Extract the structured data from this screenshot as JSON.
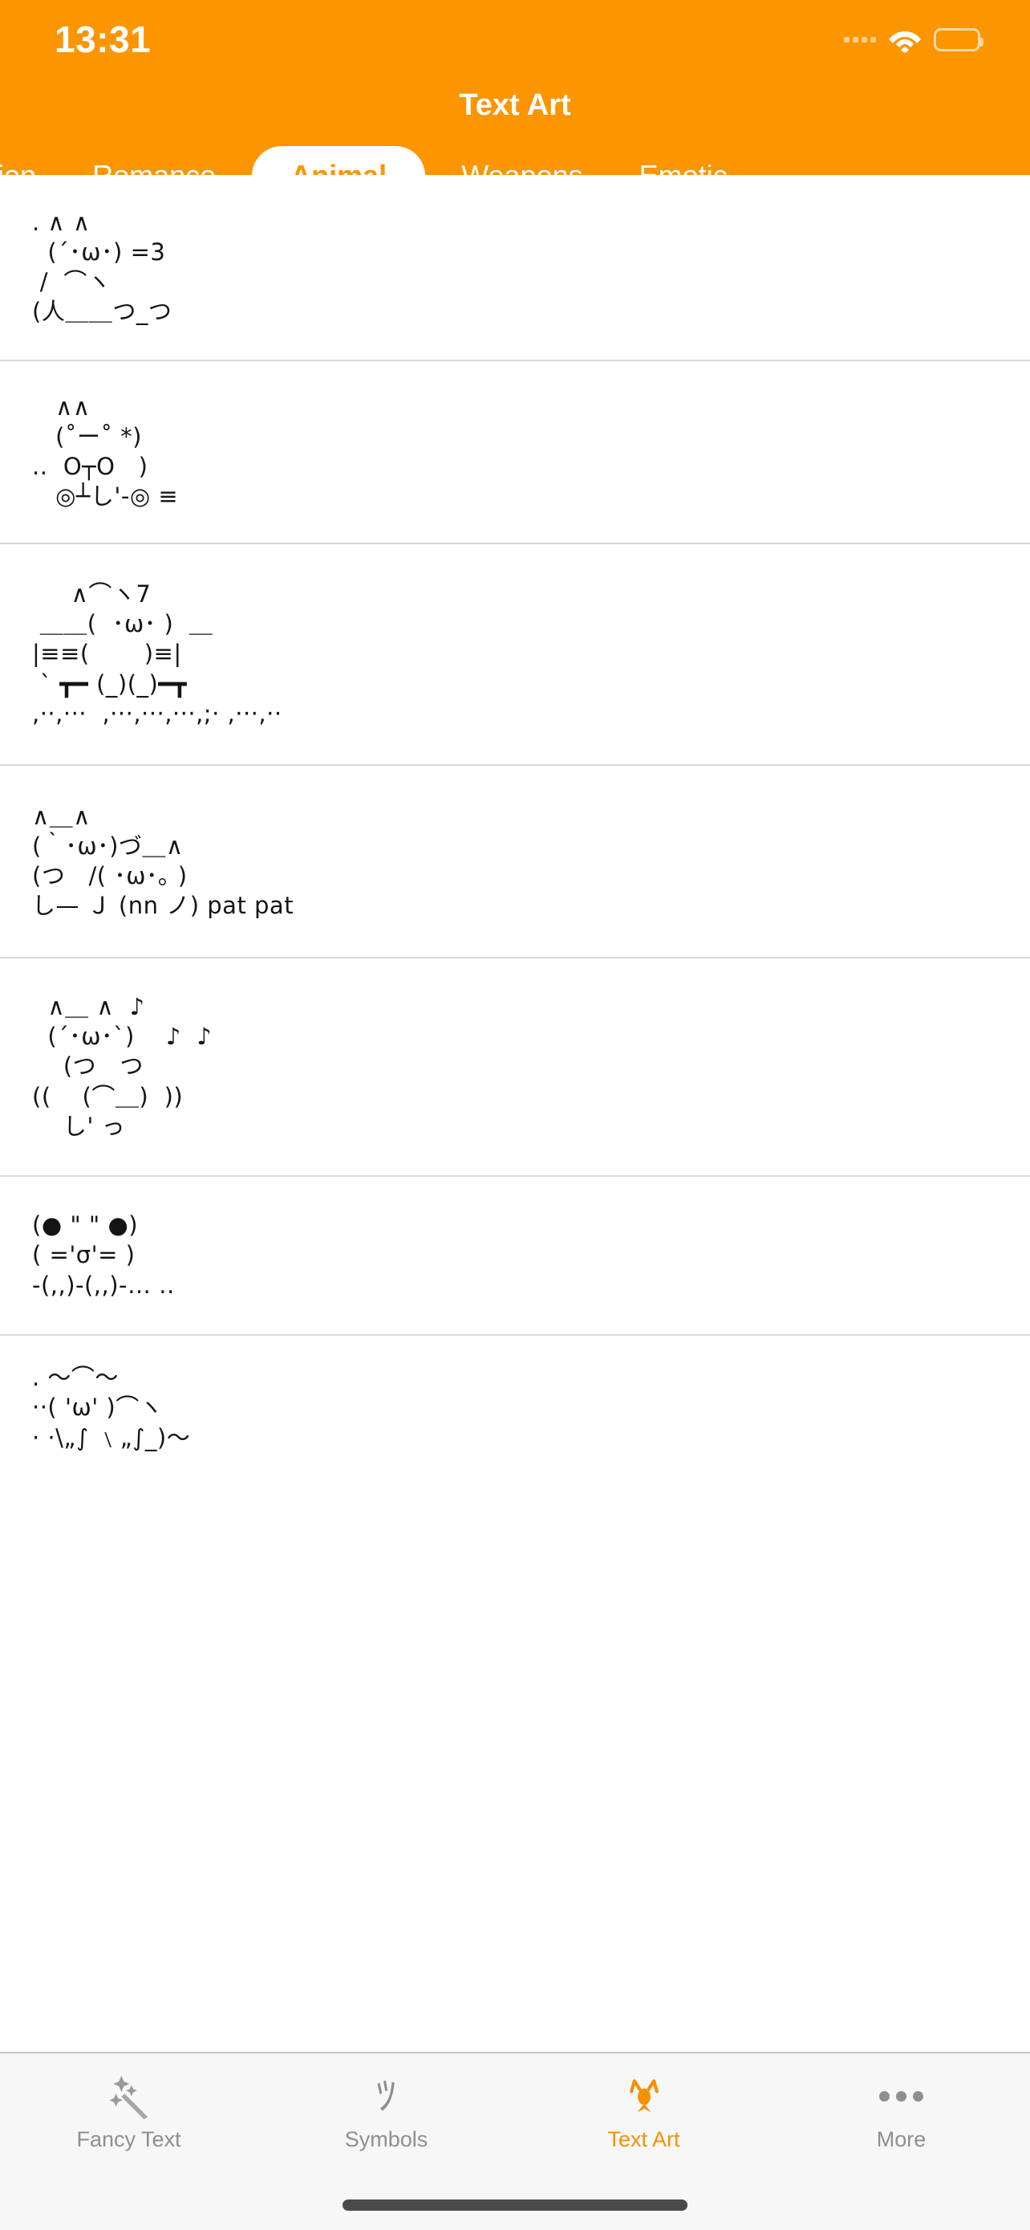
{
  "status_bar": {
    "time": "13:31",
    "signal_icon": "signal-dots-icon",
    "wifi_icon": "wifi-icon",
    "battery_icon": "battery-icon"
  },
  "header": {
    "title": "Text Art",
    "background_color": "#FC9500",
    "title_color": "#FFFFFF"
  },
  "category_tabs": {
    "selected": "Animal",
    "selected_pill_bg": "#FFFFFF",
    "selected_pill_text_color": "#FC9500",
    "items": [
      {
        "label": "oration",
        "active": false
      },
      {
        "label": "Romance",
        "active": false
      },
      {
        "label": "Animal",
        "active": true
      },
      {
        "label": "Weapons",
        "active": false
      },
      {
        "label": "Emotic",
        "active": false
      }
    ]
  },
  "art_list": {
    "items": [
      {
        "id": "art-1",
        "art": ". ∧ ∧\n  (´･ω･) =3\n /  ⌒ヽ\n(人＿＿つ_つ"
      },
      {
        "id": "art-2",
        "art": "   ∧∧\n   (˚ー˚ *)\n..  O┬O   )\n   ◎┴し'-◎ ≡"
      },
      {
        "id": "art-3",
        "art": "     ∧⌒ヽ7\n ＿＿(  ･ω･ )  ＿\n|≡≡(       )≡|\n ` ┳━ (_)(_)━┳\n,··,···  ,···,···,···,;· ,···,··"
      },
      {
        "id": "art-4",
        "art": "∧＿∧\n(｀･ω･)づ＿∧\n(つ   /( ･ω･｡ )\nし— Ｊ (nn ノ) pat pat"
      },
      {
        "id": "art-5",
        "art": "  ∧＿ ∧  ♪\n  (´･ω･`)    ♪  ♪\n    (つ   つ\n((    (⌒＿)  ))\n    し' っ"
      },
      {
        "id": "art-6",
        "art": "(● \" \" ●)\n( ='σ'= )\n-(,,)-(,,)-… .."
      },
      {
        "id": "art-7",
        "art": ". ～⌒～\n··( 'ω' )⌒ヽ\n· ·\\„∫ ﹨„∫_)〜"
      }
    ]
  },
  "tab_bar": {
    "active": "Text Art",
    "active_color": "#F59100",
    "inactive_color": "#8E8E93",
    "background": "#F7F7F7",
    "items": [
      {
        "label": "Fancy Text",
        "icon": "sparkle-wand-icon",
        "active": false
      },
      {
        "label": "Symbols",
        "icon": "katakana-tsu-icon",
        "glyph": "ﾂ",
        "active": false
      },
      {
        "label": "Text Art",
        "icon": "cat-face-icon",
        "glyph": "^ᴥ^",
        "active": true
      },
      {
        "label": "More",
        "icon": "ellipsis-icon",
        "active": false
      }
    ]
  }
}
